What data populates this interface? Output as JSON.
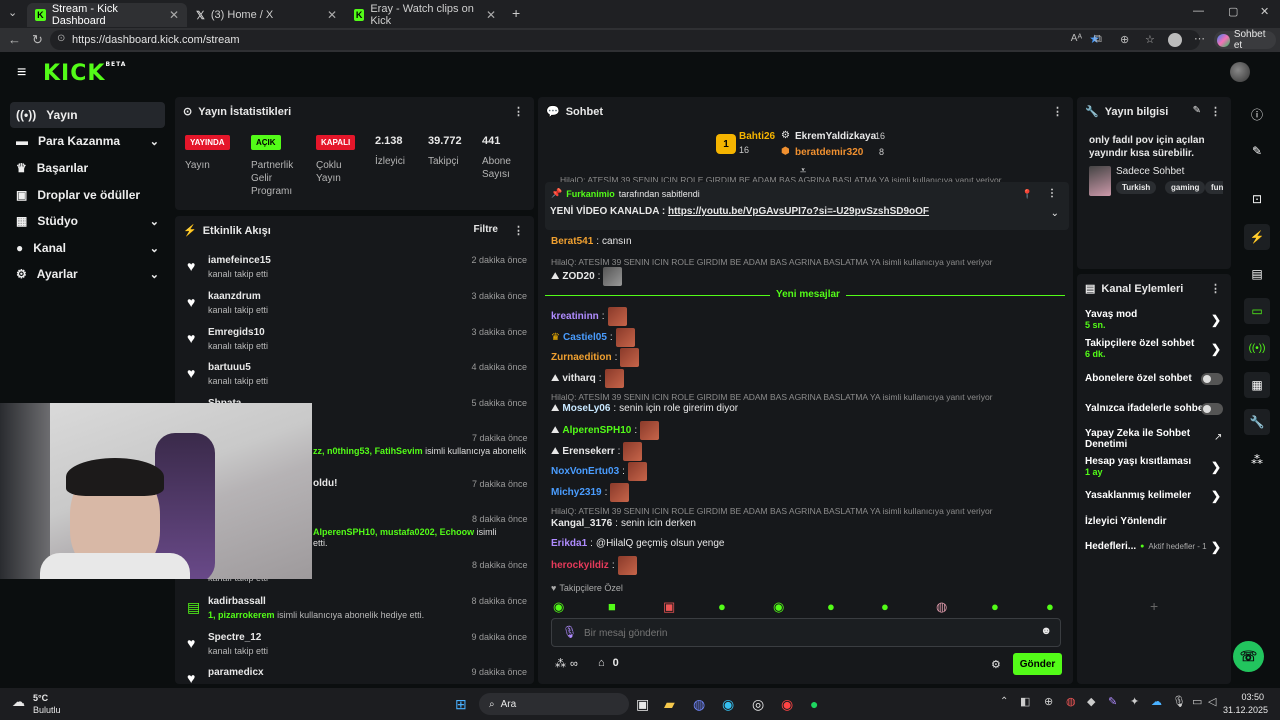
{
  "browser": {
    "tabs": [
      {
        "label": "Stream - Kick Dashboard"
      },
      {
        "label": "(3) Home / X"
      },
      {
        "label": "Eray - Watch clips on Kick"
      }
    ],
    "url": "https://dashboard.kick.com/stream",
    "sohbet_label": "Sohbet et"
  },
  "logo": {
    "text": "KICK",
    "sup": "BETA"
  },
  "sidebar": {
    "items": [
      {
        "label": "Yayın",
        "icon": "broadcast-icon"
      },
      {
        "label": "Para Kazanma",
        "icon": "money-icon"
      },
      {
        "label": "Başarılar",
        "icon": "trophy-icon"
      },
      {
        "label": "Droplar ve ödüller",
        "icon": "gift-icon"
      },
      {
        "label": "Stüdyo",
        "icon": "studio-icon"
      },
      {
        "label": "Kanal",
        "icon": "user-icon"
      },
      {
        "label": "Ayarlar",
        "icon": "gear-icon"
      }
    ]
  },
  "stats": {
    "title": "Yayın İstatistikleri",
    "badges": [
      {
        "badge": "YAYINDA",
        "label": "Yayın",
        "color": "#e5162a"
      },
      {
        "badge": "AÇIK",
        "label": "Partnerlik Gelir Programı",
        "color": "#53fc18"
      },
      {
        "badge": "KAPALI",
        "label": "Çoklu Yayın",
        "color": "#e5162a"
      }
    ],
    "numbers": [
      {
        "value": "2.138",
        "label": "İzleyici"
      },
      {
        "value": "39.772",
        "label": "Takipçi"
      },
      {
        "value": "441",
        "label": "Abone Sayısı"
      }
    ]
  },
  "activity": {
    "title": "Etkinlik Akışı",
    "filter": "Filtre",
    "rows": [
      {
        "user": "iamefeince15",
        "sub": "kanalı takip etti",
        "time": "2 dakika önce"
      },
      {
        "user": "kaanzdrum",
        "sub": "kanalı takip etti",
        "time": "3 dakika önce"
      },
      {
        "user": "Emregids10",
        "sub": "kanalı takip etti",
        "time": "3 dakika önce"
      },
      {
        "user": "bartuuu5",
        "sub": "kanalı takip etti",
        "time": "4 dakika önce"
      },
      {
        "user": "Shpata",
        "sub": "",
        "time": "5 dakika önce"
      }
    ],
    "partial": {
      "t6": "7 dakika önce",
      "line6a": "zz,",
      "line6b": "n0thing53,",
      "line6c": "FatihSevim",
      "line6d": "isimli kullanıcıya abonelik",
      "t7": "7 dakika önce",
      "line7": "oldu!",
      "t8": "8 dakika önce",
      "line8a": "AlperenSPH10,",
      "line8b": "mustafa0202,",
      "line8c": "Echoow",
      "line8d": "isimli",
      "line8e": "etti.",
      "t9": "8 dakika önce",
      "line9": "kanalı takip etti"
    },
    "rows2": [
      {
        "user": "kadirbassall",
        "sub1": "1,",
        "sub2": "pizarrokerem",
        "sub3": "isimli kullanıcıya abonelik hediye etti.",
        "time": "8 dakika önce"
      },
      {
        "user": "Spectre_12",
        "sub": "kanalı takip etti",
        "time": "9 dakika önce"
      },
      {
        "user": "paramedicx",
        "sub": "",
        "time": "9 dakika önce"
      }
    ]
  },
  "chat": {
    "title": "Sohbet",
    "leaders": [
      {
        "rank": "1",
        "name": "Bahti26",
        "count": "16"
      },
      {
        "name": "EkremYaldizkaya",
        "count": "16"
      },
      {
        "name": "beratdemir320",
        "count": "8"
      }
    ],
    "top_reply": "HilalQ: ATESİM 39 SENIN ICIN ROLE GIRDIM BE ADAM BAS AGRINA BASLATMA YA isimli kullanıcıya yanıt veriyor",
    "pinned": {
      "by": "Furkanimio",
      "by_suffix": "tarafından sabitlendi",
      "text": "YENİ VİDEO KANALDA :",
      "link": "https://youtu.be/VpGAvsUPI7o?si=-U29pvSzshSD9oOF"
    },
    "new_messages": "Yeni mesajlar",
    "reply_text": "HilalQ: ATESİM 39 SENIN ICIN ROLE GIRDIM BE ADAM BAS AGRINA BASLATMA YA isimli kullanıcıya yanıt veriyor",
    "messages": [
      {
        "user": "Berat541",
        "text": "cansın",
        "color": "#f0a030"
      },
      {
        "user": "ZOD20",
        "text": "",
        "color": "#ffffff"
      },
      {
        "user": "kreatininn",
        "text": "",
        "color": "#b08cff"
      },
      {
        "user": "Castiel05",
        "text": "",
        "color": "#4a9dff"
      },
      {
        "user": "Zurnaedition",
        "text": "",
        "color": "#f0a030"
      },
      {
        "user": "vitharq",
        "text": "",
        "color": "#ffffff"
      },
      {
        "user": "MoseLy06",
        "text": "senin için role girerim diyor",
        "color": "#c8e8ff"
      },
      {
        "user": "AlperenSPH10",
        "text": "",
        "color": "#53fc18"
      },
      {
        "user": "Erensekerr",
        "text": "",
        "color": "#ffffff"
      },
      {
        "user": "NoxVonErtu03",
        "text": "",
        "color": "#4a9dff"
      },
      {
        "user": "Michy2319",
        "text": "",
        "color": "#4a9dff"
      },
      {
        "user": "Kangal_3176",
        "text": "senin icin derken",
        "color": "#ffffff"
      },
      {
        "user": "Erikda1",
        "text": "@HilalQ geçmiş olsun yenge",
        "color": "#b08cff"
      },
      {
        "user": "herockyildiz",
        "text": "",
        "color": "#e53a5a"
      }
    ],
    "followers_only": "Takipçilere Özel",
    "placeholder": "Bir mesaj gönderin",
    "viewers": "0",
    "send": "Gönder",
    "infinity": "∞"
  },
  "stream_info": {
    "title": "Yayın bilgisi",
    "desc": "only fadıl pov için açılan yayındır kısa sürebilir.",
    "category": "Sadece Sohbet",
    "tags": [
      "Turkish",
      "gaming",
      "fun"
    ]
  },
  "channel_actions": {
    "title": "Kanal Eylemleri",
    "items": [
      {
        "label": "Yavaş mod",
        "value": "5 sn.",
        "kind": "arrow"
      },
      {
        "label": "Takipçilere özel sohbet",
        "value": "6 dk.",
        "kind": "arrow"
      },
      {
        "label": "Abonelere özel sohbet",
        "value": "",
        "kind": "toggle"
      },
      {
        "label": "Yalnızca ifadelerle sohbet",
        "value": "",
        "kind": "toggle"
      },
      {
        "label": "Yapay Zeka ile Sohbet Denetimi",
        "value": "",
        "kind": "external"
      },
      {
        "label": "Hesap yaşı kısıtlaması",
        "value": "1 ay",
        "kind": "arrow"
      },
      {
        "label": "Yasaklanmış kelimeler",
        "value": "",
        "kind": "arrow"
      },
      {
        "label": "İzleyici Yönlendir",
        "value": "",
        "kind": "none"
      },
      {
        "label": "Hedefleri...",
        "value": "Aktif hedefler - 1",
        "kind": "arrow"
      }
    ]
  },
  "taskbar": {
    "weather_temp": "5°C",
    "weather_desc": "Bulutlu",
    "search": "Ara",
    "time": "03:50",
    "date": "31.12.2025"
  }
}
